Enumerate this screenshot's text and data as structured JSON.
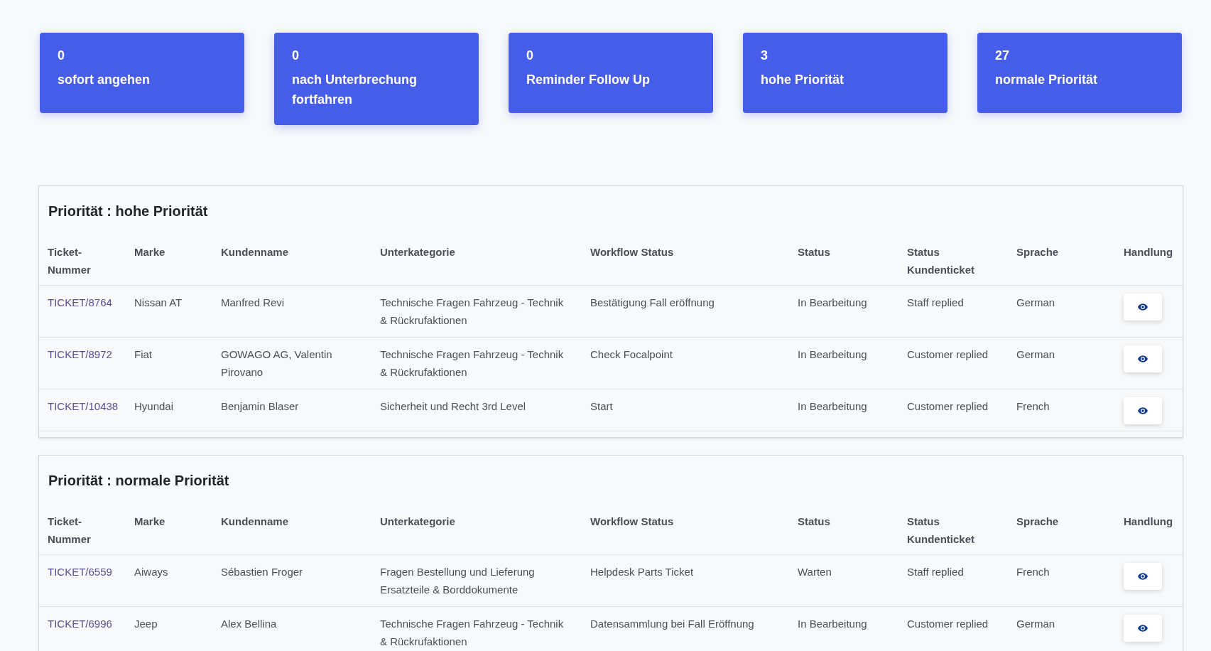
{
  "cards": [
    {
      "count": "0",
      "label": "sofort angehen"
    },
    {
      "count": "0",
      "label": "nach Unterbrechung fortfahren"
    },
    {
      "count": "0",
      "label": "Reminder Follow Up"
    },
    {
      "count": "3",
      "label": "hohe Priorität"
    },
    {
      "count": "27",
      "label": "normale Priorität"
    }
  ],
  "panels": [
    {
      "title": "Priorität : hohe Priorität",
      "columns": [
        "Ticket-Nummer",
        "Marke",
        "Kundenname",
        "Unterkategorie",
        "Workflow Status",
        "Status",
        "Status Kundenticket",
        "Sprache",
        "Handlung"
      ],
      "rows": [
        {
          "cells": [
            "TICKET/8764",
            "Nissan AT",
            "Manfred Revi",
            "Technische Fragen Fahrzeug - Technik & Rückrufaktionen",
            "Bestätigung Fall eröffnung",
            "In Bearbeitung",
            "Staff replied",
            "German"
          ]
        },
        {
          "cells": [
            "TICKET/8972",
            "Fiat",
            "GOWAGO AG, Valentin Pirovano",
            "Technische Fragen Fahrzeug - Technik & Rückrufaktionen",
            "Check Focalpoint",
            "In Bearbeitung",
            "Customer replied",
            "German"
          ]
        },
        {
          "cells": [
            "TICKET/10438",
            "Hyundai",
            "Benjamin Blaser",
            "Sicherheit und Recht 3rd Level",
            "Start",
            "In Bearbeitung",
            "Customer replied",
            "French"
          ]
        }
      ]
    },
    {
      "title": "Priorität : normale Priorität",
      "columns": [
        "Ticket-Nummer",
        "Marke",
        "Kundenname",
        "Unterkategorie",
        "Workflow Status",
        "Status",
        "Status Kundenticket",
        "Sprache",
        "Handlung"
      ],
      "rows": [
        {
          "cells": [
            "TICKET/6559",
            "Aiways",
            "Sébastien Froger",
            "Fragen Bestellung und Lieferung Ersatzteile & Borddokumente",
            "Helpdesk Parts Ticket",
            "Warten",
            "Staff replied",
            "French"
          ]
        },
        {
          "cells": [
            "TICKET/6996",
            "Jeep",
            "Alex Bellina",
            "Technische Fragen Fahrzeug - Technik & Rückrufaktionen",
            "Datensammlung bei Fall Eröffnung",
            "In Bearbeitung",
            "Customer replied",
            "German"
          ]
        }
      ]
    }
  ]
}
